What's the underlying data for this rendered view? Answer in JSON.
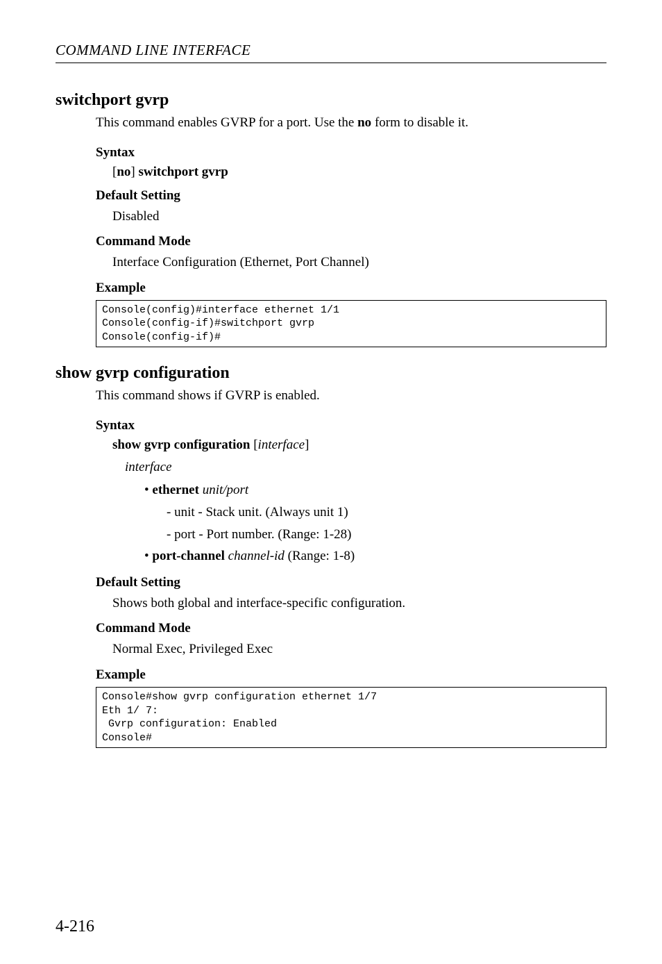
{
  "header": {
    "title": "COMMAND LINE INTERFACE"
  },
  "section1": {
    "title": "switchport gvrp",
    "desc_prefix": "This command enables GVRP for a port. Use the ",
    "desc_bold": "no",
    "desc_suffix": " form to disable it.",
    "syntax_heading": "Syntax",
    "syntax_bracket_open": "[",
    "syntax_no": "no",
    "syntax_bracket_close": "] ",
    "syntax_cmd": "switchport gvrp",
    "default_heading": "Default Setting",
    "default_value": "Disabled",
    "mode_heading": "Command Mode",
    "mode_value": "Interface Configuration (Ethernet, Port Channel)",
    "example_heading": "Example",
    "code": "Console(config)#interface ethernet 1/1\nConsole(config-if)#switchport gvrp\nConsole(config-if)#"
  },
  "section2": {
    "title": "show gvrp configuration",
    "desc": "This command shows if GVRP is enabled.",
    "syntax_heading": "Syntax",
    "syntax_cmd": "show gvrp configuration",
    "syntax_bracket_open": " [",
    "syntax_param": "interface",
    "syntax_bracket_close": "]",
    "interface_label": "interface",
    "bullet1_bold": "ethernet",
    "bullet1_italic": " unit/port",
    "dash1": "-  unit - Stack unit. (Always unit 1)",
    "dash2": "-  port - Port number. (Range: 1-28)",
    "bullet2_bold": "port-channel",
    "bullet2_italic": " channel-id",
    "bullet2_rest": " (Range: 1-8)",
    "default_heading": "Default Setting",
    "default_value": "Shows both global and interface-specific configuration.",
    "mode_heading": "Command Mode",
    "mode_value": "Normal Exec, Privileged Exec",
    "example_heading": "Example",
    "code": "Console#show gvrp configuration ethernet 1/7\nEth 1/ 7:\n Gvrp configuration: Enabled\nConsole#"
  },
  "page_number": "4-216"
}
